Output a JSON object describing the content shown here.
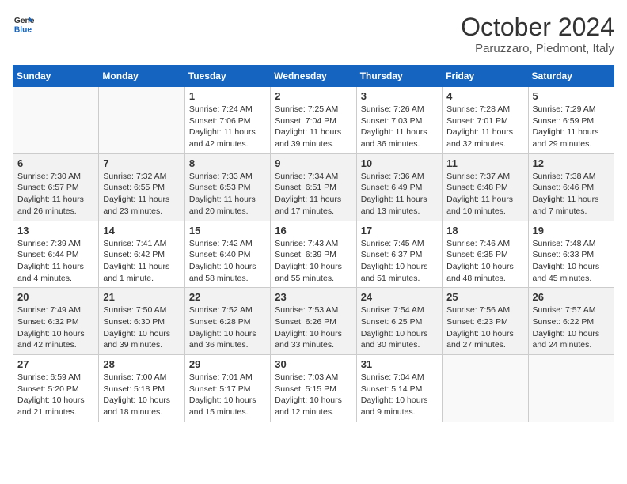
{
  "header": {
    "logo_line1": "General",
    "logo_line2": "Blue",
    "month": "October 2024",
    "location": "Paruzzaro, Piedmont, Italy"
  },
  "weekdays": [
    "Sunday",
    "Monday",
    "Tuesday",
    "Wednesday",
    "Thursday",
    "Friday",
    "Saturday"
  ],
  "weeks": [
    [
      {
        "day": "",
        "info": ""
      },
      {
        "day": "",
        "info": ""
      },
      {
        "day": "1",
        "info": "Sunrise: 7:24 AM\nSunset: 7:06 PM\nDaylight: 11 hours and 42 minutes."
      },
      {
        "day": "2",
        "info": "Sunrise: 7:25 AM\nSunset: 7:04 PM\nDaylight: 11 hours and 39 minutes."
      },
      {
        "day": "3",
        "info": "Sunrise: 7:26 AM\nSunset: 7:03 PM\nDaylight: 11 hours and 36 minutes."
      },
      {
        "day": "4",
        "info": "Sunrise: 7:28 AM\nSunset: 7:01 PM\nDaylight: 11 hours and 32 minutes."
      },
      {
        "day": "5",
        "info": "Sunrise: 7:29 AM\nSunset: 6:59 PM\nDaylight: 11 hours and 29 minutes."
      }
    ],
    [
      {
        "day": "6",
        "info": "Sunrise: 7:30 AM\nSunset: 6:57 PM\nDaylight: 11 hours and 26 minutes."
      },
      {
        "day": "7",
        "info": "Sunrise: 7:32 AM\nSunset: 6:55 PM\nDaylight: 11 hours and 23 minutes."
      },
      {
        "day": "8",
        "info": "Sunrise: 7:33 AM\nSunset: 6:53 PM\nDaylight: 11 hours and 20 minutes."
      },
      {
        "day": "9",
        "info": "Sunrise: 7:34 AM\nSunset: 6:51 PM\nDaylight: 11 hours and 17 minutes."
      },
      {
        "day": "10",
        "info": "Sunrise: 7:36 AM\nSunset: 6:49 PM\nDaylight: 11 hours and 13 minutes."
      },
      {
        "day": "11",
        "info": "Sunrise: 7:37 AM\nSunset: 6:48 PM\nDaylight: 11 hours and 10 minutes."
      },
      {
        "day": "12",
        "info": "Sunrise: 7:38 AM\nSunset: 6:46 PM\nDaylight: 11 hours and 7 minutes."
      }
    ],
    [
      {
        "day": "13",
        "info": "Sunrise: 7:39 AM\nSunset: 6:44 PM\nDaylight: 11 hours and 4 minutes."
      },
      {
        "day": "14",
        "info": "Sunrise: 7:41 AM\nSunset: 6:42 PM\nDaylight: 11 hours and 1 minute."
      },
      {
        "day": "15",
        "info": "Sunrise: 7:42 AM\nSunset: 6:40 PM\nDaylight: 10 hours and 58 minutes."
      },
      {
        "day": "16",
        "info": "Sunrise: 7:43 AM\nSunset: 6:39 PM\nDaylight: 10 hours and 55 minutes."
      },
      {
        "day": "17",
        "info": "Sunrise: 7:45 AM\nSunset: 6:37 PM\nDaylight: 10 hours and 51 minutes."
      },
      {
        "day": "18",
        "info": "Sunrise: 7:46 AM\nSunset: 6:35 PM\nDaylight: 10 hours and 48 minutes."
      },
      {
        "day": "19",
        "info": "Sunrise: 7:48 AM\nSunset: 6:33 PM\nDaylight: 10 hours and 45 minutes."
      }
    ],
    [
      {
        "day": "20",
        "info": "Sunrise: 7:49 AM\nSunset: 6:32 PM\nDaylight: 10 hours and 42 minutes."
      },
      {
        "day": "21",
        "info": "Sunrise: 7:50 AM\nSunset: 6:30 PM\nDaylight: 10 hours and 39 minutes."
      },
      {
        "day": "22",
        "info": "Sunrise: 7:52 AM\nSunset: 6:28 PM\nDaylight: 10 hours and 36 minutes."
      },
      {
        "day": "23",
        "info": "Sunrise: 7:53 AM\nSunset: 6:26 PM\nDaylight: 10 hours and 33 minutes."
      },
      {
        "day": "24",
        "info": "Sunrise: 7:54 AM\nSunset: 6:25 PM\nDaylight: 10 hours and 30 minutes."
      },
      {
        "day": "25",
        "info": "Sunrise: 7:56 AM\nSunset: 6:23 PM\nDaylight: 10 hours and 27 minutes."
      },
      {
        "day": "26",
        "info": "Sunrise: 7:57 AM\nSunset: 6:22 PM\nDaylight: 10 hours and 24 minutes."
      }
    ],
    [
      {
        "day": "27",
        "info": "Sunrise: 6:59 AM\nSunset: 5:20 PM\nDaylight: 10 hours and 21 minutes."
      },
      {
        "day": "28",
        "info": "Sunrise: 7:00 AM\nSunset: 5:18 PM\nDaylight: 10 hours and 18 minutes."
      },
      {
        "day": "29",
        "info": "Sunrise: 7:01 AM\nSunset: 5:17 PM\nDaylight: 10 hours and 15 minutes."
      },
      {
        "day": "30",
        "info": "Sunrise: 7:03 AM\nSunset: 5:15 PM\nDaylight: 10 hours and 12 minutes."
      },
      {
        "day": "31",
        "info": "Sunrise: 7:04 AM\nSunset: 5:14 PM\nDaylight: 10 hours and 9 minutes."
      },
      {
        "day": "",
        "info": ""
      },
      {
        "day": "",
        "info": ""
      }
    ]
  ]
}
